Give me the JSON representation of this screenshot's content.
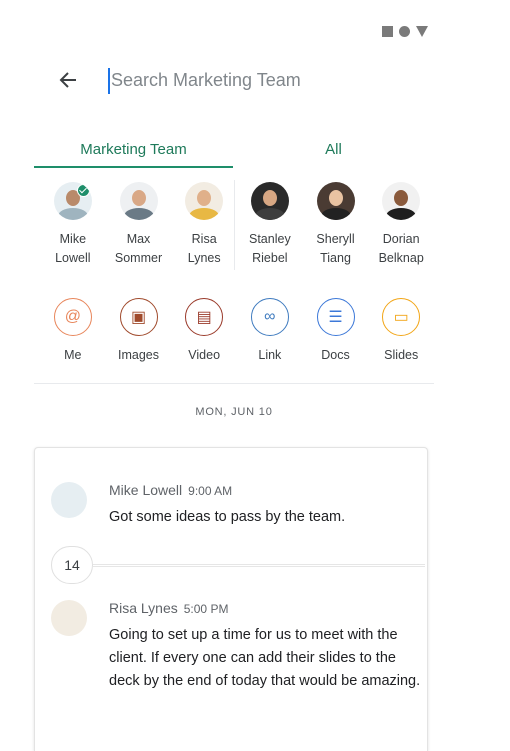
{
  "status_bar": {
    "icons": [
      "square-icon",
      "circle-icon",
      "triangle-icon"
    ]
  },
  "search": {
    "placeholder": "Search Marketing Team",
    "value": ""
  },
  "tabs": [
    {
      "label": "Marketing Team",
      "active": true
    },
    {
      "label": "All",
      "active": false
    }
  ],
  "people": [
    {
      "name": "Mike\nLowell",
      "checked": true,
      "skin": "#b98a6a",
      "shirt": "#9fb4bf",
      "bg": "#e6eef2"
    },
    {
      "name": "Max\nSommer",
      "skin": "#d9a886",
      "shirt": "#6a7a86",
      "bg": "#eef0f2"
    },
    {
      "name": "Risa\nLynes",
      "skin": "#e0b08a",
      "shirt": "#e8b844",
      "bg": "#f2ece2"
    },
    {
      "name": "Stanley\nRiebel",
      "skin": "#d7a783",
      "shirt": "#3d3d3d",
      "bg": "#2a2a2a"
    },
    {
      "name": "Sheryll\nTiang",
      "skin": "#e9c3a2",
      "shirt": "#222222",
      "bg": "#4a3b33"
    },
    {
      "name": "Dorian\nBelknap",
      "skin": "#8a5a3c",
      "shirt": "#1e1e1e",
      "bg": "#f1f1f1"
    }
  ],
  "filters": [
    {
      "label": "Me",
      "icon": "at-icon",
      "color": "#e8865b",
      "glyph": "@"
    },
    {
      "label": "Images",
      "icon": "image-icon",
      "color": "#a04a2c",
      "glyph": "▣"
    },
    {
      "label": "Video",
      "icon": "video-icon",
      "color": "#9a3a2a",
      "glyph": "▤"
    },
    {
      "label": "Link",
      "icon": "link-icon",
      "color": "#3f7bbf",
      "glyph": "∞"
    },
    {
      "label": "Docs",
      "icon": "docs-icon",
      "color": "#3c78d8",
      "glyph": "☰"
    },
    {
      "label": "Slides",
      "icon": "slides-icon",
      "color": "#f2a618",
      "glyph": "▭"
    }
  ],
  "date_label": "MON, JUN 10",
  "messages": [
    {
      "author": "Mike Lowell",
      "time": "9:00 AM",
      "text": "Got some ideas to pass by the team.",
      "skin": "#6b4a36",
      "shirt": "#9fb4bf",
      "bg": "#e6eef2"
    },
    {
      "author": "Risa Lynes",
      "time": "5:00 PM",
      "text": "Going to set up a time for us to meet with the client. If every one can add their slides to the deck by the end of today that would be amazing.",
      "skin": "#e0b08a",
      "shirt": "#e8b844",
      "bg": "#f2ece2"
    }
  ],
  "reply_count": "14"
}
